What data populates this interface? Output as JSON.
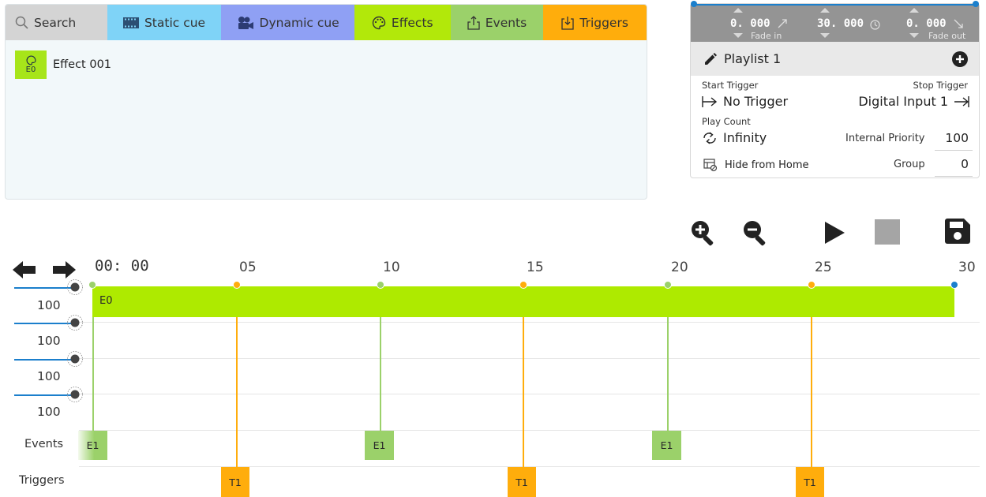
{
  "tabs": {
    "search": "Search",
    "static_cue": "Static cue",
    "dynamic_cue": "Dynamic cue",
    "effects": "Effects",
    "events": "Events",
    "triggers": "Triggers"
  },
  "library": {
    "item_code": "E0",
    "item_name": "Effect 001"
  },
  "fade": {
    "fade_in_value": "0. 000",
    "fade_in_label": "Fade in",
    "duration_value": "30. 000",
    "fade_out_value": "0. 000",
    "fade_out_label": "Fade out"
  },
  "playlist": {
    "name": "Playlist 1",
    "start_trigger_label": "Start Trigger",
    "start_trigger_value": "No Trigger",
    "stop_trigger_label": "Stop Trigger",
    "stop_trigger_value": "Digital Input 1",
    "play_count_label": "Play Count",
    "play_count_value": "Infinity",
    "internal_priority_label": "Internal Priority",
    "internal_priority_value": "100",
    "hide_from_home_label": "Hide from Home",
    "group_label": "Group",
    "group_value": "0"
  },
  "timeline": {
    "start_time": "00: 00",
    "ticks": [
      "05",
      "10",
      "15",
      "20",
      "25",
      "30"
    ],
    "track_label": "E0",
    "levels": [
      "100",
      "100",
      "100",
      "100"
    ],
    "events_label": "Events",
    "triggers_label": "Triggers",
    "events": [
      "E1",
      "E1",
      "E1"
    ],
    "triggers": [
      "T1",
      "T1",
      "T1"
    ]
  },
  "colors": {
    "effects": "#aeea00",
    "events": "#9bd16a",
    "triggers": "#ffad0c",
    "accent": "#1b7fcc"
  }
}
